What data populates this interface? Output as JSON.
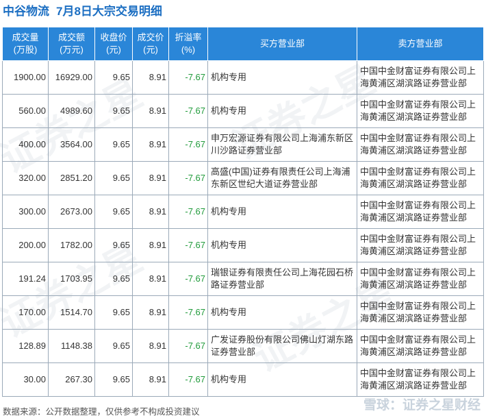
{
  "title": {
    "stock": "中谷物流",
    "subtitle": "7月8日大宗交易明细"
  },
  "headers": {
    "volume": "成交量\n(万股)",
    "amount": "成交额\n(万元)",
    "close": "收盘价\n(元)",
    "price": "成交价\n(元)",
    "premium": "折溢率\n(%)",
    "buyer": "买方营业部",
    "seller": "卖方营业部"
  },
  "rows": [
    {
      "volume": "1900.00",
      "amount": "16929.00",
      "close": "9.65",
      "price": "8.91",
      "premium": "-7.67",
      "buyer": "机构专用",
      "seller": "中国中金财富证券有限公司上海黄浦区湖滨路证券营业部"
    },
    {
      "volume": "560.00",
      "amount": "4989.60",
      "close": "9.65",
      "price": "8.91",
      "premium": "-7.67",
      "buyer": "机构专用",
      "seller": "中国中金财富证券有限公司上海黄浦区湖滨路证券营业部"
    },
    {
      "volume": "400.00",
      "amount": "3564.00",
      "close": "9.65",
      "price": "8.91",
      "premium": "-7.67",
      "buyer": "申万宏源证券有限公司上海浦东新区川沙路证券营业部",
      "seller": "中国中金财富证券有限公司上海黄浦区湖滨路证券营业部"
    },
    {
      "volume": "320.00",
      "amount": "2851.20",
      "close": "9.65",
      "price": "8.91",
      "premium": "-7.67",
      "buyer": "高盛(中国)证券有限责任公司上海浦东新区世纪大道证券营业部",
      "seller": "中国中金财富证券有限公司上海黄浦区湖滨路证券营业部"
    },
    {
      "volume": "300.00",
      "amount": "2673.00",
      "close": "9.65",
      "price": "8.91",
      "premium": "-7.67",
      "buyer": "机构专用",
      "seller": "中国中金财富证券有限公司上海黄浦区湖滨路证券营业部"
    },
    {
      "volume": "200.00",
      "amount": "1782.00",
      "close": "9.65",
      "price": "8.91",
      "premium": "-7.67",
      "buyer": "机构专用",
      "seller": "中国中金财富证券有限公司上海黄浦区湖滨路证券营业部"
    },
    {
      "volume": "191.24",
      "amount": "1703.95",
      "close": "9.65",
      "price": "8.91",
      "premium": "-7.67",
      "buyer": "瑞银证券有限责任公司上海花园石桥路证券营业部",
      "seller": "中国中金财富证券有限公司上海黄浦区湖滨路证券营业部"
    },
    {
      "volume": "170.00",
      "amount": "1514.70",
      "close": "9.65",
      "price": "8.91",
      "premium": "-7.67",
      "buyer": "机构专用",
      "seller": "中国中金财富证券有限公司上海黄浦区湖滨路证券营业部"
    },
    {
      "volume": "128.89",
      "amount": "1148.38",
      "close": "9.65",
      "price": "8.91",
      "premium": "-7.67",
      "buyer": "广发证券股份有限公司佛山灯湖东路证券营业部",
      "seller": "中国中金财富证券有限公司上海黄浦区湖滨路证券营业部"
    },
    {
      "volume": "30.00",
      "amount": "267.30",
      "close": "9.65",
      "price": "8.91",
      "premium": "-7.67",
      "buyer": "机构专用",
      "seller": "中国中金财富证券有限公司上海黄浦区湖滨路证券营业部"
    }
  ],
  "footer": "数据来源：公开数据整理，仅供参考不构成投资建议",
  "brand": "雪球：证券之星财经",
  "watermark": "证券之星",
  "colors": {
    "title": "#1b6ec2",
    "header_bg": "#2a86d8",
    "premium": "#1f9a3a"
  }
}
